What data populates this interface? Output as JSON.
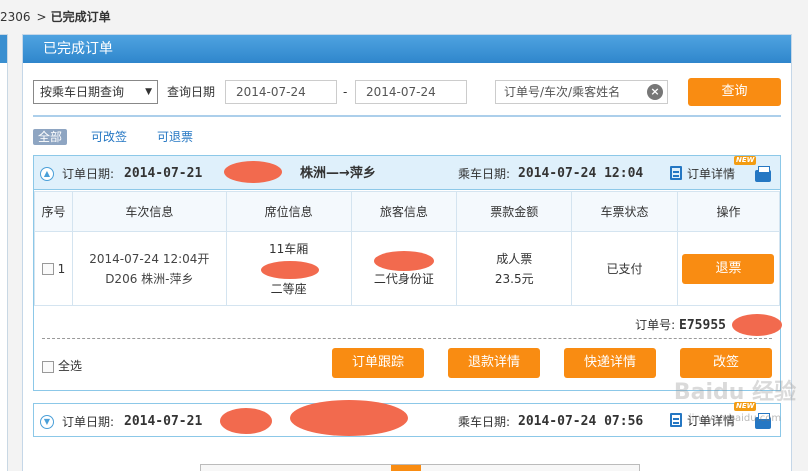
{
  "breadcrumb": {
    "prefix": "2306",
    "separator": ">",
    "current": "已完成订单"
  },
  "panel": {
    "title": "已完成订单"
  },
  "search": {
    "query_type": "按乘车日期查询",
    "date_label": "查询日期",
    "date_from": "2014-07-24",
    "date_to": "2014-07-24",
    "dash": "-",
    "keyword_placeholder": "订单号/车次/乘客姓名",
    "query_button": "查询"
  },
  "filters": [
    "全部",
    "可改签",
    "可退票"
  ],
  "orders": [
    {
      "order_date_label": "订单日期:",
      "order_date": "2014-07-21",
      "route": "株洲—→萍乡",
      "travel_date_label": "乘车日期:",
      "travel_datetime": "2014-07-24 12:04",
      "detail_link": "订单详情",
      "new_badge": "NEW",
      "columns": [
        "序号",
        "车次信息",
        "席位信息",
        "旅客信息",
        "票款金额",
        "车票状态",
        "操作"
      ],
      "rows": [
        {
          "index": "1",
          "train_line1": "2014-07-24 12:04开",
          "train_line2": "D206 株洲-萍乡",
          "seat_line1": "11车厢",
          "seat_line3": "二等座",
          "passenger_id": "二代身份证",
          "fare_type": "成人票",
          "fare_amount": "23.5元",
          "status": "已支付",
          "action": "退票"
        }
      ],
      "order_no_label": "订单号:",
      "order_no": "E75955",
      "select_all": "全选",
      "actions": [
        "订单跟踪",
        "退款详情",
        "快递详情",
        "改签"
      ]
    },
    {
      "order_date_label": "订单日期:",
      "order_date": "2014-07-21",
      "travel_date_label": "乘车日期:",
      "travel_datetime": "2014-07-24 07:56",
      "detail_link": "订单详情",
      "new_badge": "NEW"
    }
  ],
  "watermark": {
    "main": "Baidu 经验",
    "sub": "jingyan.baidu.com"
  },
  "colors": {
    "accent": "#f98c12",
    "header_blue": "#2f86cc",
    "link": "#2577c3",
    "redaction": "#f26a4e"
  },
  "icons": [
    "chevron-up-icon",
    "chevron-down-icon",
    "clear-icon",
    "document-icon",
    "printer-icon",
    "dropdown-caret-icon"
  ]
}
